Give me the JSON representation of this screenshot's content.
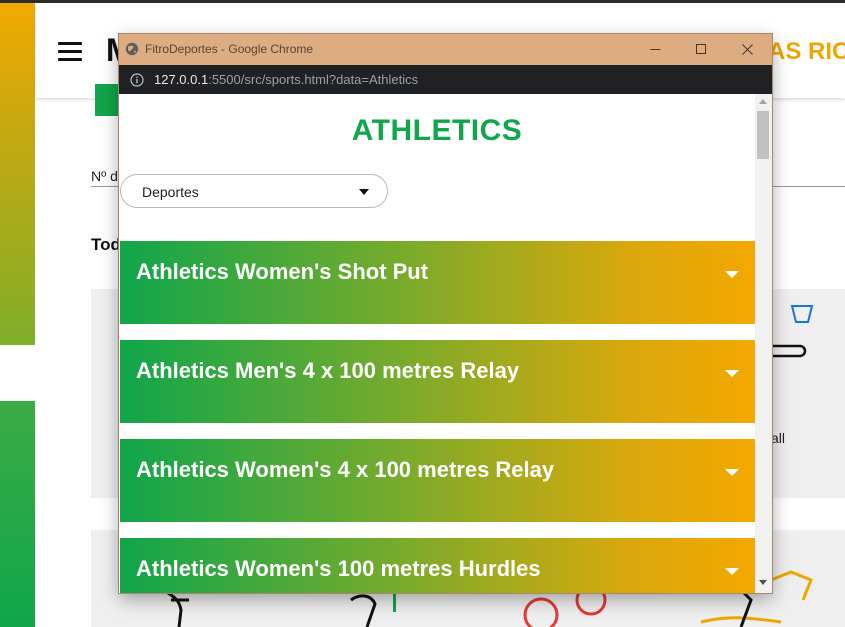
{
  "background_page": {
    "logo_fragment": "M",
    "brand_fragment": "AS RIC",
    "count_label_fragment": "Nº d",
    "section_heading_fragment": "Tod",
    "card_text_fragment": "all"
  },
  "window": {
    "title": "FitroDeportes - Google Chrome",
    "url_host": "127.0.0.1",
    "url_rest": ":5500/src/sports.html?data=Athletics"
  },
  "page": {
    "title": "ATHLETICS",
    "select": {
      "value": "Deportes"
    },
    "events": [
      {
        "label": "Athletics Women's Shot Put"
      },
      {
        "label": "Athletics Men's 4 x 100 metres Relay"
      },
      {
        "label": "Athletics Women's 4 x 100 metres Relay"
      },
      {
        "label": "Athletics Women's 100 metres Hurdles"
      }
    ]
  },
  "colors": {
    "accent_green": "#10a64b",
    "accent_orange": "#f4a800",
    "titlebar": "#ddac81",
    "addressbar": "#202124"
  },
  "icons": [
    "menu-icon",
    "trophy-icon",
    "hurdle-icon",
    "info-icon",
    "minimize-icon",
    "maximize-icon",
    "close-icon",
    "chevron-down-icon"
  ]
}
